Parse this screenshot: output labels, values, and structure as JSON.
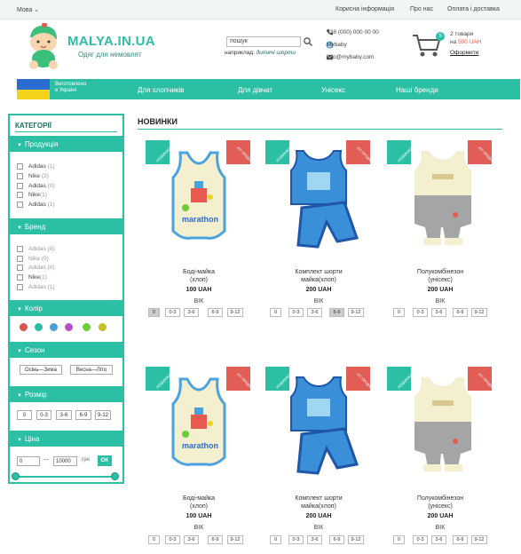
{
  "topbar": {
    "lang": "Мова",
    "links": [
      "Корисна інформація",
      "Про нас",
      "Оплата і доставка"
    ]
  },
  "header": {
    "logo": "MALYA.IN.UA",
    "tagline": "Одяг для немовлят",
    "search_value": "пошук",
    "search_hint_prefix": "наприклад:",
    "search_hint_example": "дитячі шорти",
    "phone": "+38 (000) 000 00 00",
    "skype": "Mybaby",
    "email": "info@mybaby.com",
    "cart_count": "5",
    "cart_line1": "2 товари",
    "cart_prefix": "на",
    "cart_sum": "500 UAH",
    "cart_link": "Оформити"
  },
  "nav": {
    "made_in": [
      "Виготовлено",
      "в Україні"
    ],
    "items": [
      "Для хлопчиків",
      "Для дівчат",
      "Унісекс",
      "Наші бренди"
    ]
  },
  "sidebar": {
    "title": "КАТЕГОРІЇ",
    "sections": {
      "products": "Продукція",
      "brand": "Бренд",
      "color": "Колір",
      "season": "Сезон",
      "size": "Розмір",
      "price": "Ціна"
    },
    "products": [
      {
        "label": "Adidas",
        "count": "(1)"
      },
      {
        "label": "Nike",
        "count": "(2)"
      },
      {
        "label": "Adidas",
        "count": "(0)"
      },
      {
        "label": "Nike",
        "count": "(1)"
      },
      {
        "label": "Adidas",
        "count": "(1)"
      }
    ],
    "brands": [
      {
        "label": "Adidas",
        "count": "(0)"
      },
      {
        "label": "Nike",
        "count": "(0)"
      },
      {
        "label": "Adidas",
        "count": "(0)"
      },
      {
        "label": "Nike",
        "count": "(1)"
      },
      {
        "label": "Adidas",
        "count": "(1)"
      }
    ],
    "colors": [
      "#d9534f",
      "#2bbfa4",
      "#4a9fd6",
      "#b84fc8",
      "#6dcc3a",
      "#c8c02a"
    ],
    "seasons": [
      "Осінь—Зима",
      "Весна—Літо"
    ],
    "sizes": [
      "0",
      "0-3",
      "3-6",
      "6-9",
      "9-12"
    ],
    "price_from": "0",
    "price_dash": "—",
    "price_to": "10000",
    "currency": "грн",
    "ok": "OK"
  },
  "content": {
    "title": "НОВИНКИ",
    "badge_new": "НОВИНКА",
    "badge_hit": "ХІТ ПРОДАЖУ",
    "vik_label": "ВІК",
    "products": [
      {
        "name1": "Боді-майка",
        "name2": "(хлоп)",
        "price": "100 UAH",
        "sizes": [
          "0",
          "0-3",
          "3-6",
          "6-9",
          "9-12"
        ]
      },
      {
        "name1": "Комплект шорти",
        "name2": "майка(хлоп)",
        "price": "200 UAH",
        "sizes": [
          "0",
          "0-3",
          "3-6",
          "6-9",
          "9-12"
        ]
      },
      {
        "name1": "Полукомбінезон",
        "name2": "(унісекс)",
        "price": "200 UAH",
        "sizes": [
          "0",
          "0-3",
          "3-6",
          "6-9",
          "9-12"
        ]
      },
      {
        "name1": "Боді-майка",
        "name2": "(хлоп)",
        "price": "100 UAH",
        "sizes": [
          "0",
          "0-3",
          "3-6",
          "6-9",
          "9-12"
        ]
      },
      {
        "name1": "Комплект шорти",
        "name2": "майка(хлоп)",
        "price": "200 UAH",
        "sizes": [
          "0",
          "0-3",
          "3-6",
          "6-9",
          "9-12"
        ]
      },
      {
        "name1": "Полукомбінезон",
        "name2": "(унісекс)",
        "price": "200 UAH",
        "sizes": [
          "0",
          "0-3",
          "3-6",
          "6-9",
          "9-12"
        ]
      }
    ]
  }
}
